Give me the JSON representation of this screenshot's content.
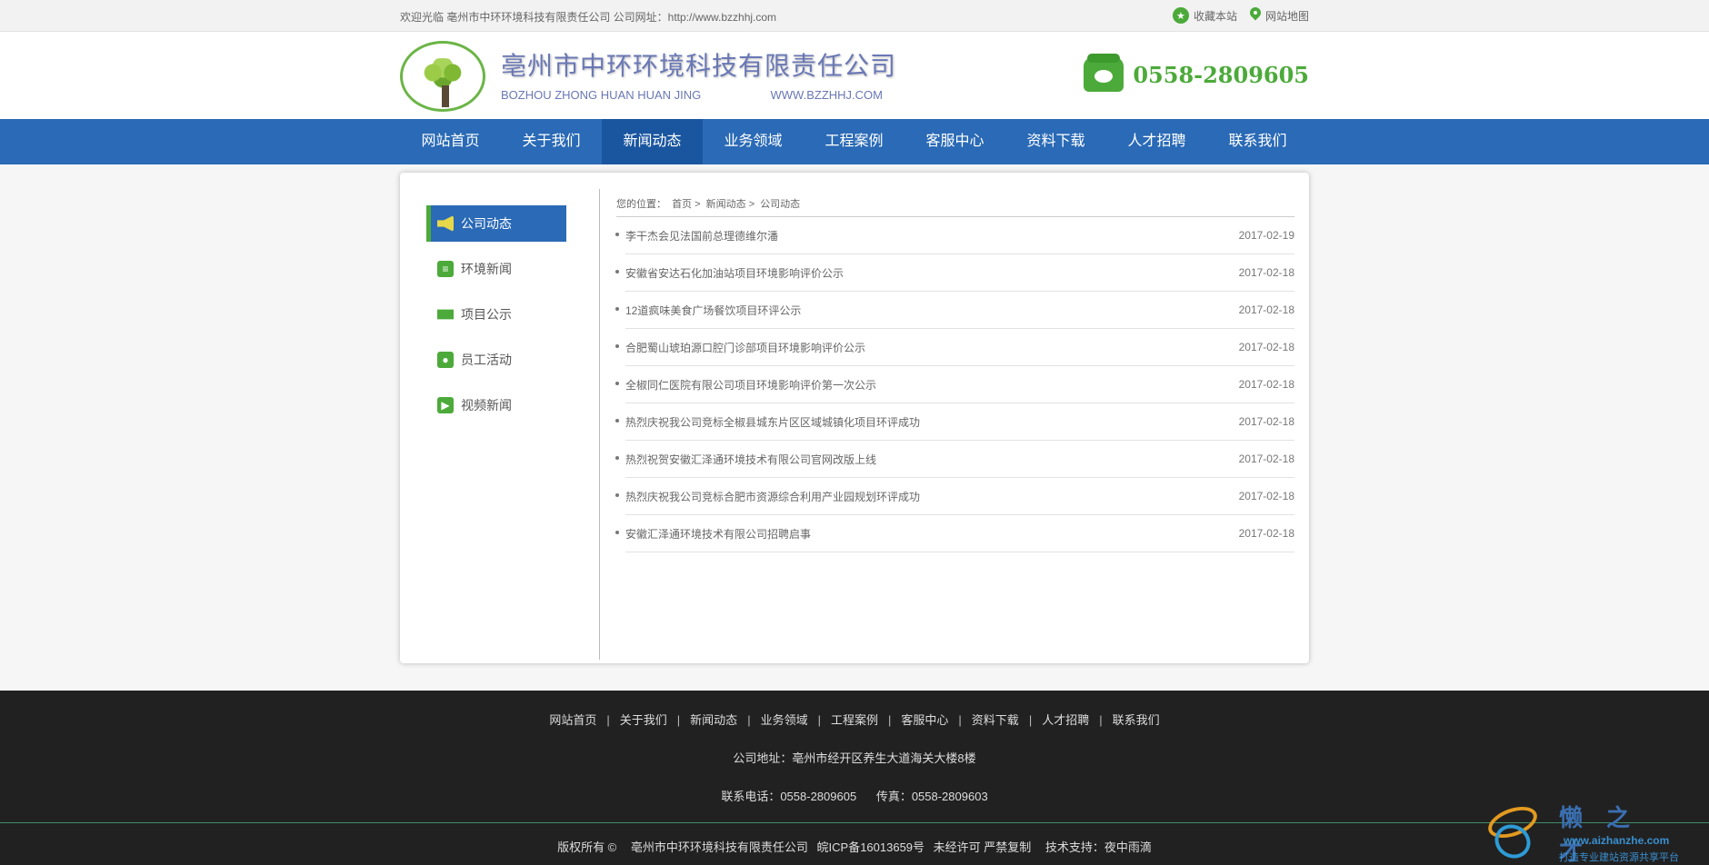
{
  "topbar": {
    "welcome": "欢迎光临 亳州市中环环境科技有限责任公司 公司网址：http://www.bzzhhj.com",
    "favorite": "收藏本站",
    "sitemap": "网站地图"
  },
  "header": {
    "company_cn": "亳州市中环环境科技有限责任公司",
    "company_en": "BOZHOU ZHONG HUAN HUAN JING",
    "company_url": "WWW.BZZHHJ.COM",
    "hotline": "0558-2809605"
  },
  "nav": {
    "items": [
      "网站首页",
      "关于我们",
      "新闻动态",
      "业务领域",
      "工程案例",
      "客服中心",
      "资料下载",
      "人才招聘",
      "联系我们"
    ],
    "active_index": 2
  },
  "sidebar": {
    "items": [
      "公司动态",
      "环境新闻",
      "项目公示",
      "员工活动",
      "视频新闻"
    ]
  },
  "breadcrumb": {
    "prefix": "您的位置：",
    "home": "首页",
    "sep": ">",
    "section": "新闻动态",
    "current": "公司动态"
  },
  "news": [
    {
      "title": "李干杰会见法国前总理德维尔潘",
      "date": "2017-02-19"
    },
    {
      "title": "安徽省安达石化加油站项目环境影响评价公示",
      "date": "2017-02-18"
    },
    {
      "title": "12道疯味美食广场餐饮项目环评公示",
      "date": "2017-02-18"
    },
    {
      "title": "合肥蜀山琥珀源口腔门诊部项目环境影响评价公示",
      "date": "2017-02-18"
    },
    {
      "title": "全椒同仁医院有限公司项目环境影响评价第一次公示",
      "date": "2017-02-18"
    },
    {
      "title": "热烈庆祝我公司竞标全椒县城东片区区域城镇化项目环评成功",
      "date": "2017-02-18"
    },
    {
      "title": "热烈祝贺安徽汇泽通环境技术有限公司官网改版上线",
      "date": "2017-02-18"
    },
    {
      "title": "热烈庆祝我公司竞标合肥市资源综合利用产业园规划环评成功",
      "date": "2017-02-18"
    },
    {
      "title": "安徽汇泽通环境技术有限公司招聘启事",
      "date": "2017-02-18"
    }
  ],
  "footer": {
    "nav": [
      "网站首页",
      "关于我们",
      "新闻动态",
      "业务领域",
      "工程案例",
      "客服中心",
      "资料下载",
      "人才招聘",
      "联系我们"
    ],
    "nav_sep": "|",
    "address": "公司地址：亳州市经开区养生大道海关大楼8楼",
    "phone": "联系电话：0558-2809605",
    "fax": "传真：0558-2809603",
    "copyright": "版权所有 ©",
    "company": "亳州市中环环境科技有限责任公司",
    "icp": "皖ICP备16013659号",
    "notice": "未经许可 严禁复制",
    "support": "技术支持：夜中雨滴"
  },
  "watermark": {
    "title": "懒之才",
    "url": "www.aizhanzhe.com",
    "slogan": "打造专业建站资源共享平台"
  },
  "colors": {
    "nav_blue": "#2a6ab6",
    "nav_active": "#1a56a0",
    "brand_green": "#4caa3a",
    "footer_bg": "#212121"
  }
}
